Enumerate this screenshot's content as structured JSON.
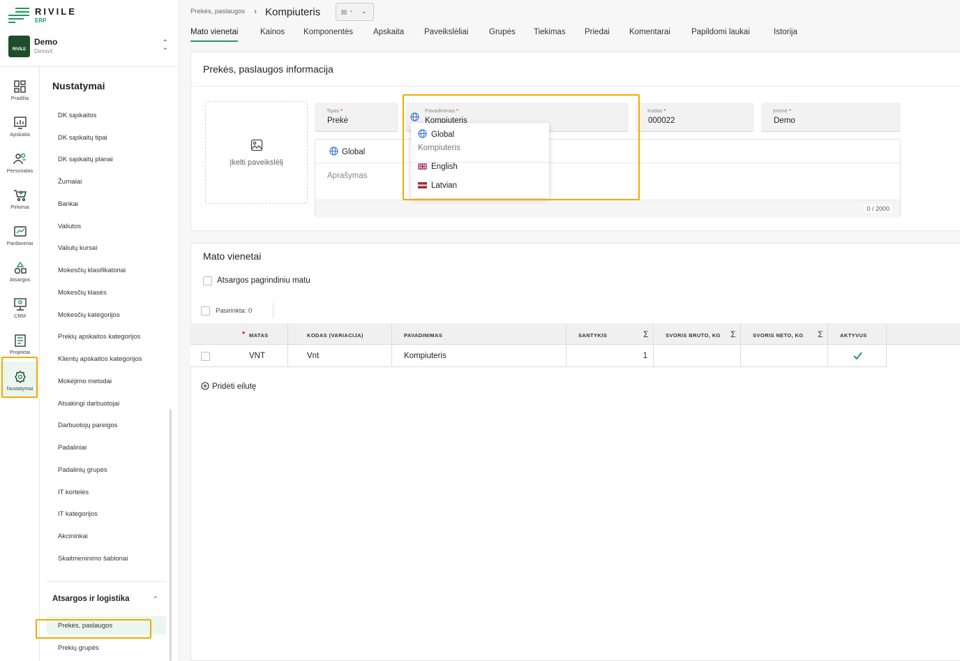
{
  "brand": {
    "name": "RIVILE",
    "sub": "ERP"
  },
  "company": {
    "logo_text": "RIVILE",
    "name": "Demo",
    "sub": "DemoX"
  },
  "rail": [
    {
      "label": "Pradžia",
      "icon": "dashboard-icon"
    },
    {
      "label": "Apskaita",
      "icon": "chart-icon"
    },
    {
      "label": "Personalas",
      "icon": "people-icon"
    },
    {
      "label": "Pirkimai",
      "icon": "cart-icon"
    },
    {
      "label": "Pardavimai",
      "icon": "sales-icon"
    },
    {
      "label": "Atsargos",
      "icon": "shapes-icon"
    },
    {
      "label": "CRM",
      "icon": "crm-icon"
    },
    {
      "label": "Projektai",
      "icon": "projects-icon"
    },
    {
      "label": "Nustatymai",
      "icon": "gear-icon"
    }
  ],
  "menu": {
    "title": "Nustatymai",
    "items": [
      "DK sąskaitos",
      "DK sąskaitų tipai",
      "DK sąskaitų planai",
      "Žurnalai",
      "Bankai",
      "Valiutos",
      "Valiutų kursai",
      "Mokesčių klasifikatoriai",
      "Mokesčių klasės",
      "Mokesčių kategorijos",
      "Prekių apskaitos kategorijos",
      "Klientų apskaitos kategorijos",
      "Mokėjimo metodai",
      "Atsakingi darbuotojai",
      "Darbuotojų pareigos",
      "Padaliniai",
      "Padalinių grupės",
      "IT kortelės",
      "IT kategorijos",
      "Akcininkai",
      "Skaitmeninimo šablonai"
    ],
    "section": "Atsargos ir logistika",
    "section_items": [
      "Prekės, paslaugos",
      "Prekių grupės"
    ]
  },
  "header": {
    "breadcrumb": "Prekės, paslaugos",
    "title": "Kompiuteris",
    "status_value": "-"
  },
  "tabs": [
    "Mato vienetai",
    "Kainos",
    "Komponentės",
    "Apskaita",
    "Paveikslėliai",
    "Grupės",
    "Tiekimas",
    "Priedai",
    "Komentarai",
    "Papildomi laukai",
    "Istorija"
  ],
  "info": {
    "title": "Prekės, paslaugos informacija",
    "upload_label": "Įkelti paveikslėlį",
    "fields": {
      "tipas": {
        "label": "Tipas",
        "value": "Prekė"
      },
      "pavadinimas": {
        "label": "Pavadinimas",
        "value": "Kompiuteris"
      },
      "kodas": {
        "label": "Kodas",
        "value": "000022"
      },
      "imone": {
        "label": "Įmonė",
        "value": "Demo"
      }
    },
    "description": {
      "lang": "Global",
      "placeholder": "Aprašymas",
      "counter": "0 / 2000"
    },
    "lang_popup": {
      "current": "Global",
      "current_value": "Kompiuteris",
      "options": [
        "English",
        "Latvian"
      ]
    }
  },
  "uom": {
    "title": "Mato vienetai",
    "base_checkbox": "Atsargos pagrindiniu matu",
    "selected": "Pasirinkta: 0",
    "columns": [
      "MATAS",
      "KODAS (VARIACIJA)",
      "PAVADINIMAS",
      "SANTYKIS",
      "SVORIS BRUTO, KG",
      "SVORIS NETO, KG",
      "AKTYVUS"
    ],
    "rows": [
      {
        "matas": "VNT",
        "kodas": "Vnt",
        "pavadinimas": "Kompiuteris",
        "santykis": "1",
        "bruto": "",
        "neto": "",
        "aktyvus": true
      }
    ],
    "add_row": "Pridėti eilutę"
  },
  "colors": {
    "accent": "#1f9a5a",
    "highlight": "#f5a900",
    "required": "#d42020"
  }
}
